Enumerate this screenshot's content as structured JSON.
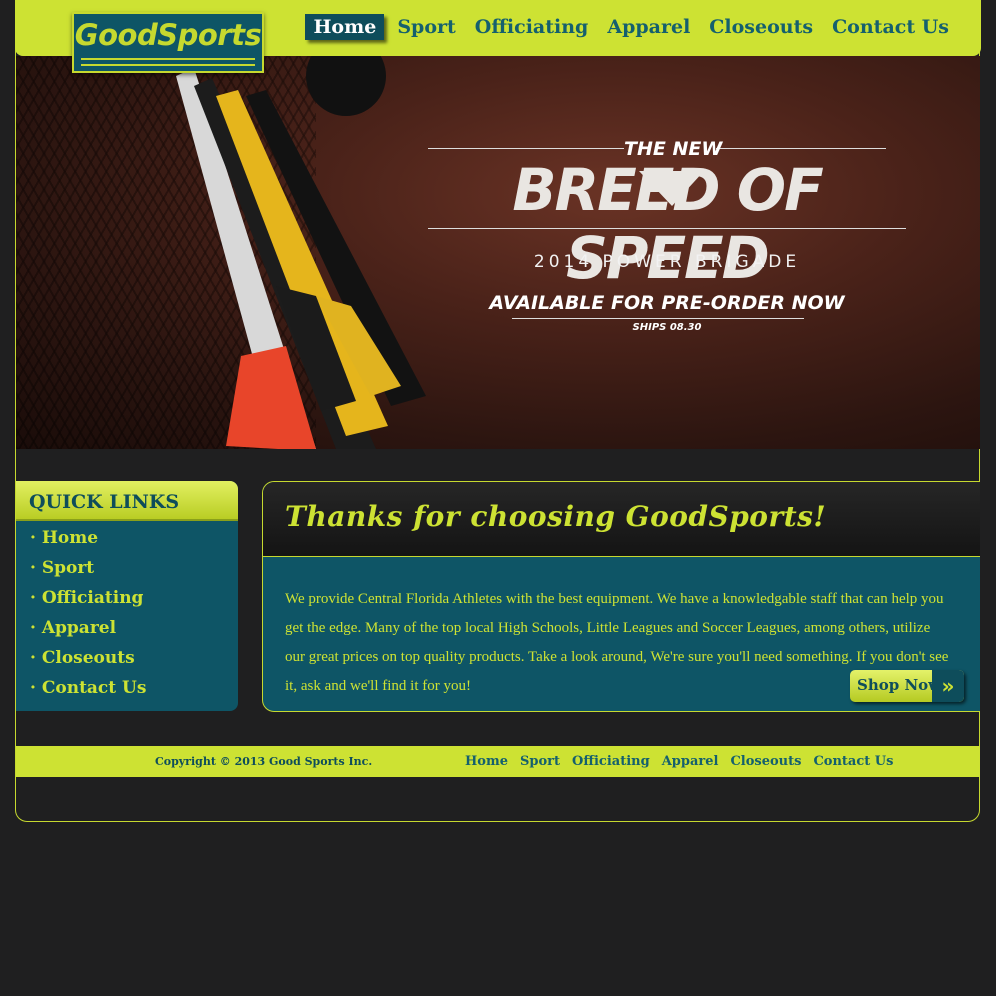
{
  "logo": {
    "text": "GoodSports"
  },
  "nav": {
    "items": [
      "Home",
      "Sport",
      "Officiating",
      "Apparel",
      "Closeouts",
      "Contact Us"
    ],
    "active": "Home"
  },
  "hero": {
    "subtitle": "THE NEW",
    "headline": "BREED OF SPEED",
    "brigade": "2014 POWER BRIGADE",
    "available": "AVAILABLE FOR PRE-ORDER NOW",
    "ships": "SHIPS 08.30"
  },
  "quick_links": {
    "title": "QUICK LINKS",
    "items": [
      "· Home",
      "· Sport",
      "· Officiating",
      "· Apparel",
      "· Closeouts",
      "· Contact Us"
    ]
  },
  "main": {
    "heading": "Thanks for choosing GoodSports!",
    "body": "We provide Central Florida Athletes with the best equipment. We have a knowledgable staff that can help you get the edge. Many of the top local High Schools, Little Leagues and Soccer Leagues, among others, utilize our great prices on top quality products. Take a look around, We're sure you'll need something. If you don't see it, ask and we'll find it for you!",
    "shop_label": "Shop Now",
    "shop_arrow": "»"
  },
  "footer": {
    "copyright": "Copyright © 2013 Good Sports Inc.",
    "links": [
      "Home",
      "Sport",
      "Officiating",
      "Apparel",
      "Closeouts",
      "Contact Us"
    ]
  },
  "colors": {
    "accent": "#cde233",
    "teal": "#0e5566",
    "background": "#1f1f20"
  }
}
